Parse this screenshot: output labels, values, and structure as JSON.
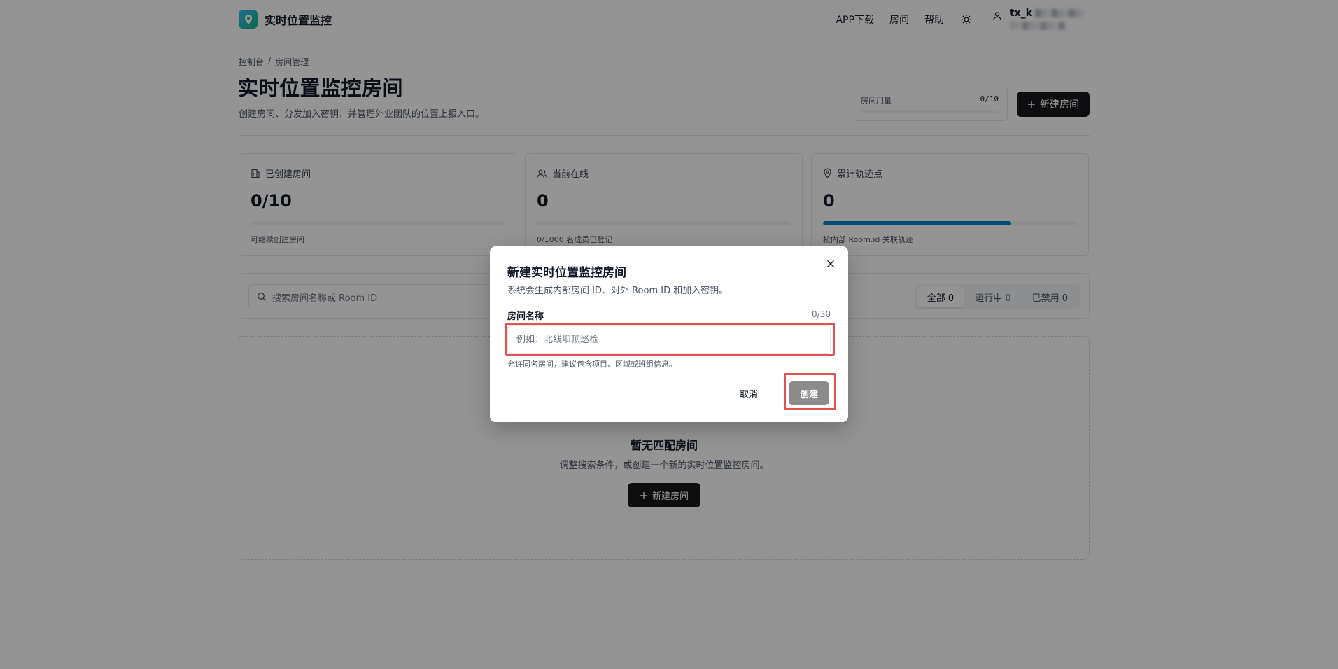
{
  "nav": {
    "brand": "实时位置监控",
    "links": [
      "APP下载",
      "房间",
      "帮助"
    ],
    "user_name_prefix": "tx_k"
  },
  "breadcrumb": [
    "控制台",
    "/",
    "房间管理"
  ],
  "page": {
    "title": "实时位置监控房间",
    "description": "创建房间、分发加入密钥，并管理外业团队的位置上报入口。",
    "usage_label": "房间用量",
    "usage_value": "0/10",
    "usage_fraction": 0,
    "new_room_button": "新建房间"
  },
  "stats": [
    {
      "label": "已创建房间",
      "value": "0/10",
      "note": "可继续创建房间",
      "icon": "building-icon",
      "fill_fraction": 0
    },
    {
      "label": "当前在线",
      "value": "0",
      "note": "0/1000 名成员已登记",
      "icon": "users-icon",
      "fill_fraction": 0
    },
    {
      "label": "累计轨迹点",
      "value": "0",
      "note": "按内部 Room.id 关联轨迹",
      "icon": "map-pin-icon",
      "fill_fraction": 0.74
    }
  ],
  "search": {
    "placeholder": "搜索房间名称或 Room ID"
  },
  "filters": [
    {
      "label": "全部 0",
      "active": true
    },
    {
      "label": "运行中 0",
      "active": false
    },
    {
      "label": "已禁用 0",
      "active": false
    }
  ],
  "empty": {
    "title": "暂无匹配房间",
    "description": "调整搜索条件，或创建一个新的实时位置监控房间。",
    "button": "新建房间"
  },
  "modal": {
    "title": "新建实时位置监控房间",
    "description": "系统会生成内部房间 ID、对外 Room ID 和加入密钥。",
    "field_label": "房间名称",
    "field_count": "0/30",
    "field_value": "",
    "field_placeholder": "例如：北线坝顶巡检",
    "field_hint": "允许同名房间，建议包含项目、区域或班组信息。",
    "cancel": "取消",
    "create": "创建"
  },
  "colors": {
    "primary": "#18181b",
    "progress": "#0284c7",
    "highlight": "#e05252",
    "disabled_button": "#8b8b8b"
  }
}
